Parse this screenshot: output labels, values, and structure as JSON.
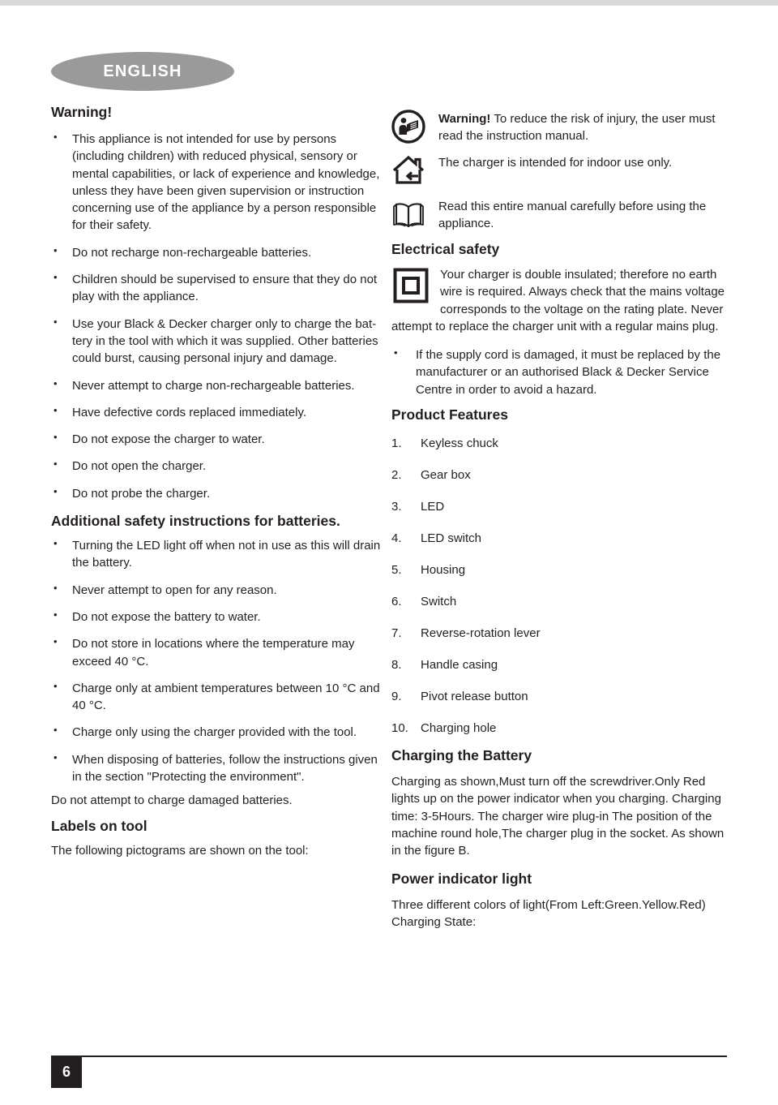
{
  "document": {
    "language_badge": "ENGLISH",
    "page_number": "6",
    "accent_gray": "#9a9a9a",
    "ink": "#231f20"
  },
  "left_column": {
    "warning_heading": "Warning!",
    "warning_bullets": [
      "This appliance is not intended for use by persons (including children) with reduced physical, sensory or mental capabilities, or lack of experience and knowledge, unless they have been given supervision or instruction concerning use of the appliance by a person responsible for their safety.",
      "Do not recharge non-rechargeable batteries.",
      "Children should be supervised to ensure that they do not play with the appliance.",
      "Use your Black & Decker charger only to charge the bat-tery in the tool with which it was supplied. Other batteries could burst, causing personal injury and damage.",
      "Never attempt to charge non-rechargeable batteries.",
      "Have defective cords replaced immediately.",
      "Do not expose the charger to water.",
      "Do not open the charger.",
      "Do not probe the charger."
    ],
    "battery_heading": "Additional safety instructions for batteries.",
    "battery_bullets": [
      "Turning the LED light off when not in use as this will drain the battery.",
      "Never attempt to open for any reason.",
      "Do not expose the battery to water.",
      "Do not store in locations where the temperature may exceed 40 °C.",
      "Charge only at ambient temperatures between 10 °C and 40 °C.",
      "Charge only using the charger provided with the tool.",
      "When disposing of batteries, follow the instructions given in the section \"Protecting the environment\"."
    ],
    "damaged_note": "Do not attempt to charge damaged batteries.",
    "labels_heading": "Labels on tool",
    "labels_intro": "The following pictograms are shown on the tool:"
  },
  "right_column": {
    "pictograms": [
      {
        "icon": "read-manual-warning-icon",
        "lead": "Warning!",
        "text": "To reduce the risk of injury, the user must read the instruction manual."
      },
      {
        "icon": "indoor-use-house-icon",
        "lead": "",
        "text": "The charger is intended for indoor use only."
      },
      {
        "icon": "open-book-icon",
        "lead": "",
        "text": "Read this entire manual carefully before using the appliance."
      }
    ],
    "electrical_heading": "Electrical safety",
    "double_insulated_text": "Your charger is double insulated; therefore no earth wire is required. Always check that the mains voltage corresponds to the voltage on the rating plate. Never attempt to replace the charger unit with a regular mains plug.",
    "electrical_bullets": [
      "If the supply cord is damaged, it must be replaced by the manufacturer or an authorised Black & Decker Service Centre in order to avoid a hazard."
    ],
    "features_heading": "Product Features",
    "features": [
      "Keyless chuck",
      "Gear box",
      "LED",
      "LED switch",
      "Housing",
      "Switch",
      "Reverse-rotation lever",
      "Handle casing",
      "Pivot release button",
      "Charging hole"
    ],
    "charging_heading": "Charging the Battery",
    "charging_text": "Charging as shown,Must turn off the screwdriver.Only Red lights up on the power indicator when you charging. Charging time: 3-5Hours. The charger wire plug-in The position of the machine round hole,The charger plug in the socket. As shown in the figure B.",
    "indicator_heading": "Power indicator light",
    "indicator_text_1": "Three different colors of light(From Left:Green.Yellow.Red)",
    "indicator_text_2": "Charging State:"
  }
}
